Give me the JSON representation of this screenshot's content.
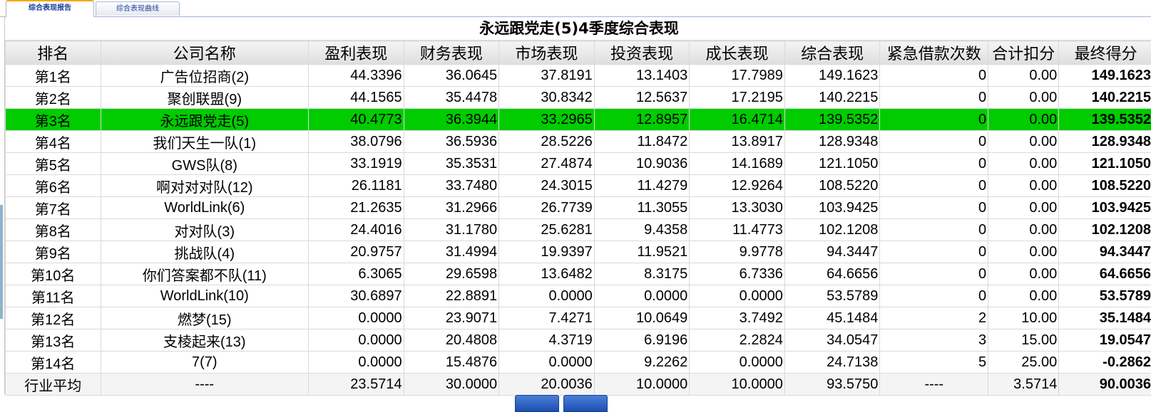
{
  "tabs": [
    {
      "label": "综合表现报告",
      "active": true
    },
    {
      "label": "综合表现曲线",
      "active": false
    }
  ],
  "report": {
    "title": "永远跟党走(5)4季度综合表现",
    "columns": [
      "排名",
      "公司名称",
      "盈利表现",
      "财务表现",
      "市场表现",
      "投资表现",
      "成长表现",
      "综合表现",
      "紧急借款次数",
      "合计扣分",
      "最终得分"
    ],
    "rows": [
      {
        "rank": "第1名",
        "company": "广告位招商(2)",
        "profit": "44.3396",
        "finance": "36.0645",
        "market": "37.8191",
        "investment": "13.1403",
        "growth": "17.7989",
        "composite": "149.1623",
        "loans": "0",
        "deduction": "0.00",
        "final": "149.1623"
      },
      {
        "rank": "第2名",
        "company": "聚创联盟(9)",
        "profit": "44.1565",
        "finance": "35.4478",
        "market": "30.8342",
        "investment": "12.5637",
        "growth": "17.2195",
        "composite": "140.2215",
        "loans": "0",
        "deduction": "0.00",
        "final": "140.2215"
      },
      {
        "rank": "第3名",
        "company": "永远跟党走(5)",
        "profit": "40.4773",
        "finance": "36.3944",
        "market": "33.2965",
        "investment": "12.8957",
        "growth": "16.4714",
        "composite": "139.5352",
        "loans": "0",
        "deduction": "0.00",
        "final": "139.5352"
      },
      {
        "rank": "第4名",
        "company": "我们天生一队(1)",
        "profit": "38.0796",
        "finance": "36.5936",
        "market": "28.5226",
        "investment": "11.8472",
        "growth": "13.8917",
        "composite": "128.9348",
        "loans": "0",
        "deduction": "0.00",
        "final": "128.9348"
      },
      {
        "rank": "第5名",
        "company": "GWS队(8)",
        "profit": "33.1919",
        "finance": "35.3531",
        "market": "27.4874",
        "investment": "10.9036",
        "growth": "14.1689",
        "composite": "121.1050",
        "loans": "0",
        "deduction": "0.00",
        "final": "121.1050"
      },
      {
        "rank": "第6名",
        "company": "啊对对对队(12)",
        "profit": "26.1181",
        "finance": "33.7480",
        "market": "24.3015",
        "investment": "11.4279",
        "growth": "12.9264",
        "composite": "108.5220",
        "loans": "0",
        "deduction": "0.00",
        "final": "108.5220"
      },
      {
        "rank": "第7名",
        "company": "WorldLink(6)",
        "profit": "21.2635",
        "finance": "31.2966",
        "market": "26.7739",
        "investment": "11.3055",
        "growth": "13.3030",
        "composite": "103.9425",
        "loans": "0",
        "deduction": "0.00",
        "final": "103.9425"
      },
      {
        "rank": "第8名",
        "company": "对对队(3)",
        "profit": "24.4016",
        "finance": "31.1780",
        "market": "25.6281",
        "investment": "9.4358",
        "growth": "11.4773",
        "composite": "102.1208",
        "loans": "0",
        "deduction": "0.00",
        "final": "102.1208"
      },
      {
        "rank": "第9名",
        "company": "挑战队(4)",
        "profit": "20.9757",
        "finance": "31.4994",
        "market": "19.9397",
        "investment": "11.9521",
        "growth": "9.9778",
        "composite": "94.3447",
        "loans": "0",
        "deduction": "0.00",
        "final": "94.3447"
      },
      {
        "rank": "第10名",
        "company": "你们答案都不队(11)",
        "profit": "6.3065",
        "finance": "29.6598",
        "market": "13.6482",
        "investment": "8.3175",
        "growth": "6.7336",
        "composite": "64.6656",
        "loans": "0",
        "deduction": "0.00",
        "final": "64.6656"
      },
      {
        "rank": "第11名",
        "company": "WorldLink(10)",
        "profit": "30.6897",
        "finance": "22.8891",
        "market": "0.0000",
        "investment": "0.0000",
        "growth": "0.0000",
        "composite": "53.5789",
        "loans": "0",
        "deduction": "0.00",
        "final": "53.5789"
      },
      {
        "rank": "第12名",
        "company": "燃梦(15)",
        "profit": "0.0000",
        "finance": "23.9071",
        "market": "7.4271",
        "investment": "10.0649",
        "growth": "3.7492",
        "composite": "45.1484",
        "loans": "2",
        "deduction": "10.00",
        "final": "35.1484"
      },
      {
        "rank": "第13名",
        "company": "支棱起来(13)",
        "profit": "0.0000",
        "finance": "20.4808",
        "market": "4.3719",
        "investment": "6.9196",
        "growth": "2.2824",
        "composite": "34.0547",
        "loans": "3",
        "deduction": "15.00",
        "final": "19.0547"
      },
      {
        "rank": "第14名",
        "company": "7(7)",
        "profit": "0.0000",
        "finance": "15.4876",
        "market": "0.0000",
        "investment": "9.2262",
        "growth": "0.0000",
        "composite": "24.7138",
        "loans": "5",
        "deduction": "25.00",
        "final": "-0.2862"
      }
    ],
    "average": {
      "rank": "行业平均",
      "company": "----",
      "profit": "23.5714",
      "finance": "30.0000",
      "market": "20.0036",
      "investment": "10.0000",
      "growth": "10.0000",
      "composite": "93.5750",
      "loans": "----",
      "deduction": "3.5714",
      "final": "90.0036"
    },
    "highlight_company": "永远跟党走(5)",
    "highlight_color": "#00cc00"
  }
}
